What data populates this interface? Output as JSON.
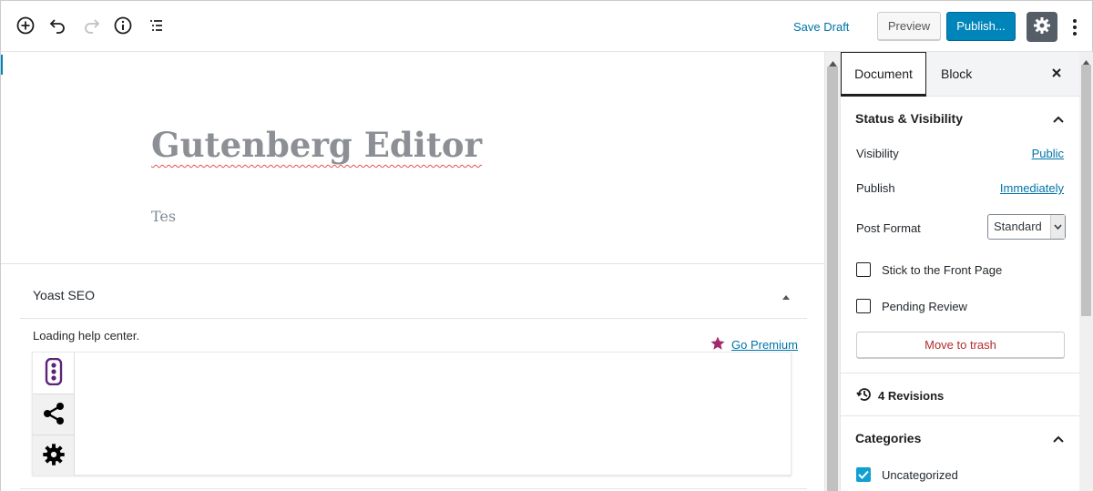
{
  "toolbar": {
    "save_draft": "Save Draft",
    "preview": "Preview",
    "publish": "Publish...",
    "icons": [
      "add-block-icon",
      "undo-icon",
      "redo-icon",
      "info-icon",
      "block-navigation-icon",
      "gear-icon",
      "more-vertical-icon"
    ]
  },
  "editor": {
    "title": "Gutenberg Editor",
    "body": "Tes"
  },
  "yoast": {
    "title": "Yoast SEO",
    "loading": "Loading help center.",
    "go_premium": "Go Premium",
    "tabs": [
      "traffic-light-icon",
      "share-icon",
      "gear-icon"
    ]
  },
  "sidebar": {
    "tabs": {
      "document": "Document",
      "block": "Block"
    },
    "status_visibility": {
      "heading": "Status & Visibility",
      "visibility_label": "Visibility",
      "visibility_value": "Public",
      "publish_label": "Publish",
      "publish_value": "Immediately",
      "post_format_label": "Post Format",
      "post_format_value": "Standard",
      "stick_front_page": "Stick to the Front Page",
      "stick_front_page_checked": false,
      "pending_review": "Pending Review",
      "pending_review_checked": false,
      "move_to_trash": "Move to trash"
    },
    "revisions": "4 Revisions",
    "categories": {
      "heading": "Categories",
      "items": [
        {
          "label": "Uncategorized",
          "checked": true
        }
      ]
    }
  },
  "colors": {
    "accent": "#0085ba",
    "link": "#0073aa",
    "danger": "#b32d2e",
    "yoast": "#a4286a",
    "settings_bg": "#555d66"
  }
}
